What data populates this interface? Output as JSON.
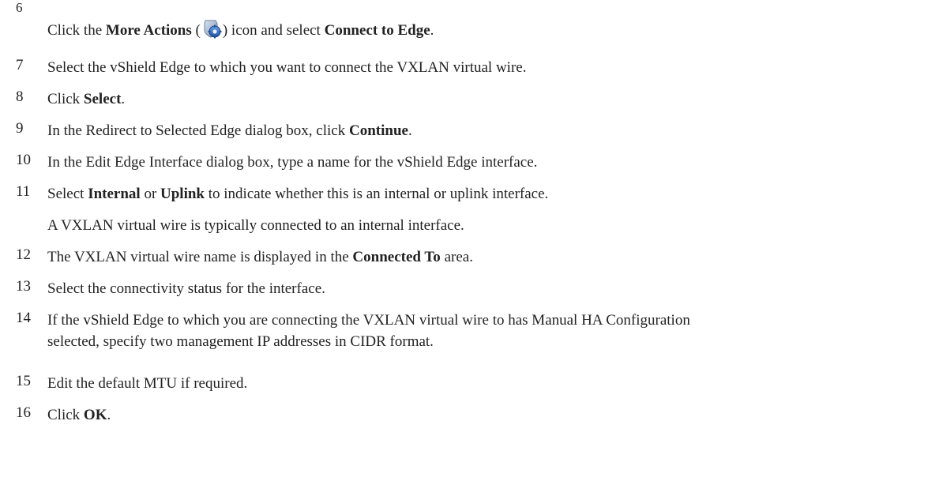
{
  "steps": [
    {
      "num": "6",
      "parts": [
        "Click the ",
        "More Actions",
        " (",
        ") icon and select ",
        "Connect to Edge",
        "."
      ],
      "icon": "gear-icon"
    },
    {
      "num": "7",
      "text": "Select the vShield Edge to which you want to connect the VXLAN virtual wire."
    },
    {
      "num": "8",
      "parts": [
        "Click ",
        "Select",
        "."
      ]
    },
    {
      "num": "9",
      "parts": [
        "In the Redirect to Selected Edge dialog box, click ",
        "Continue",
        "."
      ]
    },
    {
      "num": "10",
      "text": "In the Edit Edge Interface dialog box, type a name for the vShield Edge interface."
    },
    {
      "num": "11",
      "parts": [
        "Select ",
        "Internal",
        " or ",
        "Uplink",
        " to indicate whether this is an internal or uplink interface."
      ],
      "note": "A VXLAN virtual wire is typically connected to an internal interface."
    },
    {
      "num": "12",
      "parts": [
        "The VXLAN virtual wire name is displayed in the ",
        "Connected To",
        " area."
      ]
    },
    {
      "num": "13",
      "text": "Select the connectivity status for the interface."
    },
    {
      "num": "14",
      "line1": "If the vShield Edge to which you are connecting the VXLAN virtual wire to has Manual HA Configuration",
      "line2": "selected, specify two management IP addresses in CIDR format."
    },
    {
      "num": "15",
      "text": "Edit the default MTU if required."
    },
    {
      "num": "16",
      "parts": [
        "Click ",
        "OK",
        "."
      ]
    }
  ]
}
